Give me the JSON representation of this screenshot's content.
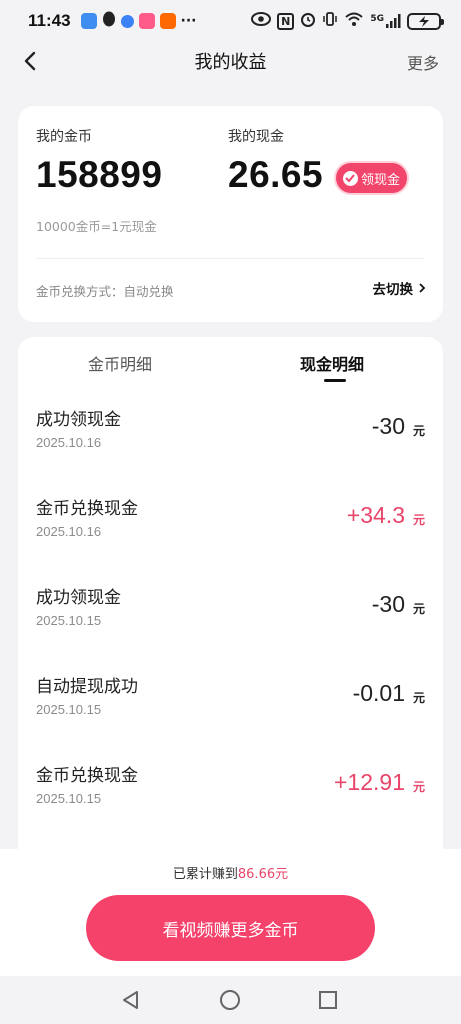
{
  "status_bar": {
    "time": "11:43",
    "dots": "···",
    "network": "5G",
    "nfc": "N",
    "colors": {
      "app1": "#3d8ef0",
      "app2": "#222222",
      "app3": "#3b82f6",
      "app4": "#ff5a8a",
      "app5": "#ff6a00"
    }
  },
  "header": {
    "title": "我的收益",
    "more_label": "更多"
  },
  "summary": {
    "coin_label": "我的金币",
    "coin_value": "158899",
    "cash_label": "我的现金",
    "cash_value": "26.65",
    "withdraw_label": "领现金",
    "rate_note": "10000金币=1元现金",
    "exchange_mode": "金币兑换方式：自动兑换",
    "switch_label": "去切换"
  },
  "tabs": [
    {
      "label": "金币明细",
      "active": false
    },
    {
      "label": "现金明细",
      "active": true
    }
  ],
  "transactions": [
    {
      "title": "成功领现金",
      "date": "2025.10.16",
      "amount": "-30",
      "unit": "元",
      "positive": false
    },
    {
      "title": "金币兑换现金",
      "date": "2025.10.16",
      "amount": "+34.3",
      "unit": "元",
      "positive": true
    },
    {
      "title": "成功领现金",
      "date": "2025.10.15",
      "amount": "-30",
      "unit": "元",
      "positive": false
    },
    {
      "title": "自动提现成功",
      "date": "2025.10.15",
      "amount": "-0.01",
      "unit": "元",
      "positive": false
    },
    {
      "title": "金币兑换现金",
      "date": "2025.10.15",
      "amount": "+12.91",
      "unit": "元",
      "positive": true
    }
  ],
  "footer": {
    "earned_prefix": "已累计赚到",
    "earned_value": "86.66元",
    "watch_button": "看视频赚更多金币"
  },
  "theme": {
    "accent": "#f5426b",
    "positive_amount": "#e8456a",
    "background": "#f3f3f5"
  }
}
